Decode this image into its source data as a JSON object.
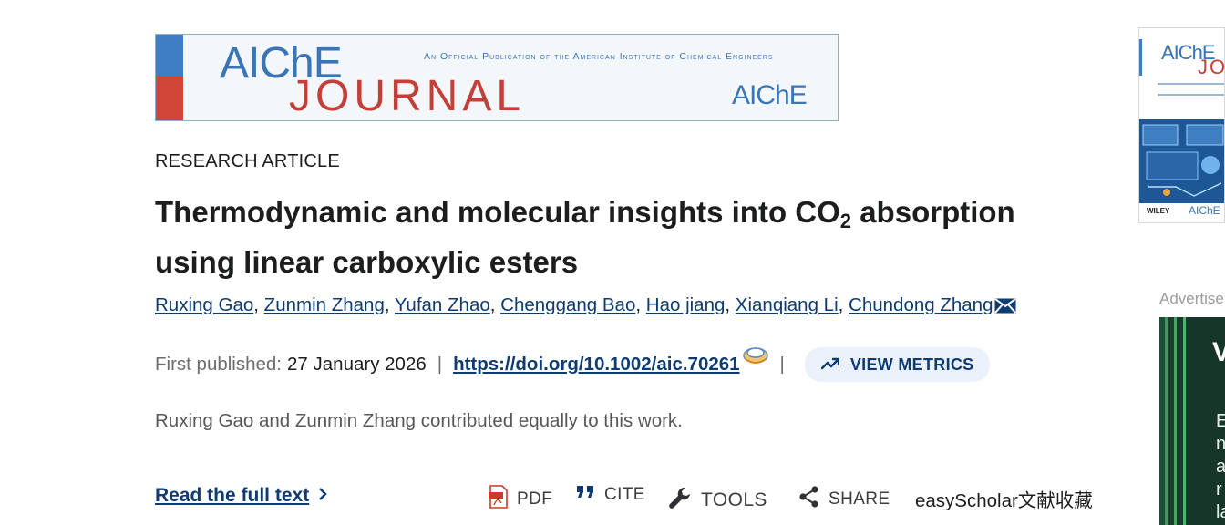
{
  "journal_banner": {
    "name_top": "AIChE",
    "name_bottom": "JOURNAL",
    "tagline": "An Official Publication of the American Institute of Chemical Engineers",
    "logo_text": "AIChE"
  },
  "article": {
    "type": "RESEARCH ARTICLE",
    "title_part1": "Thermodynamic and molecular insights into CO",
    "title_subscript": "2",
    "title_part2": " absorption using linear carboxylic esters",
    "authors": [
      "Ruxing Gao",
      "Zunmin Zhang",
      "Yufan Zhao",
      "Chenggang Bao",
      "Hao jiang",
      "Xianqiang Li",
      "Chundong Zhang"
    ],
    "first_published_label": "First published:",
    "first_published_date": "27 January 2026",
    "doi": "https://doi.org/10.1002/aic.70261",
    "view_metrics_label": "VIEW METRICS",
    "contribution_note": "Ruxing Gao and Zunmin Zhang contributed equally to this work."
  },
  "actions": {
    "read_full_text": "Read the full text",
    "pdf": "PDF",
    "cite": "CITE",
    "tools": "TOOLS",
    "share": "SHARE",
    "extension": "easyScholar文献收藏"
  },
  "right_rail": {
    "cover_title_top": "AIChE",
    "cover_title_bottom": "JOU",
    "cover_publisher": "WILEY",
    "cover_logo": "AIChE",
    "advert_label": "Advertise",
    "advert_initial": "V",
    "advert_letters": "E\nn\na\nr\nla"
  },
  "colors": {
    "link": "#0e3b72",
    "banner_blue": "#3a75b5",
    "banner_red": "#c1413a",
    "metrics_bg": "#eaf1fb"
  }
}
